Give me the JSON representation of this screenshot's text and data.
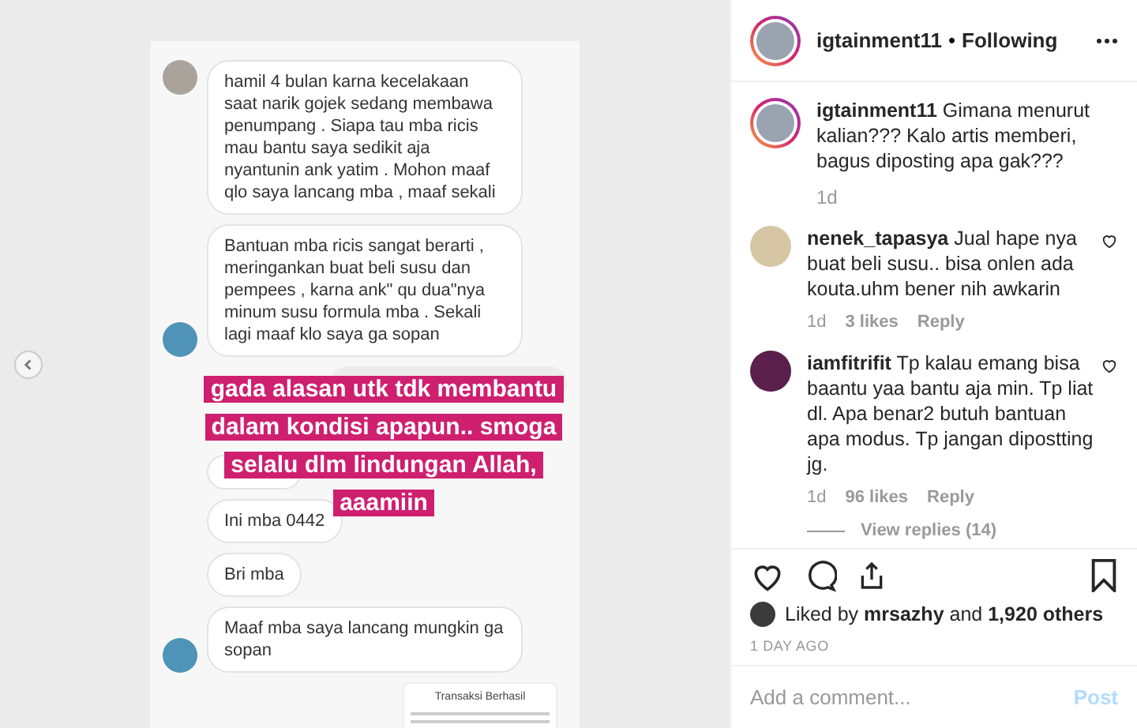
{
  "post_media": {
    "messages": [
      {
        "text": "hamil 4 bulan karna kecelakaan saat narik gojek sedang membawa penumpang . Siapa tau mba ricis mau bantu saya sedikit aja nyantunin ank yatim . Mohon maaf qlo saya lancang mba , maaf sekali",
        "kind": "avatar_top"
      },
      {
        "text": "Bantuan mba ricis sangat berarti , meringankan buat beli susu dan pempees , karna ank\" qu dua\"nya minum susu formula mba . Sekali lagi maaf klo saya ga sopan",
        "kind": "avatar_bottom"
      },
      {
        "text": "Ini mba 0442",
        "kind": "plain"
      },
      {
        "text": "Bri mba",
        "kind": "plain"
      },
      {
        "text": "Maaf mba saya lancang mungkin ga sopan",
        "kind": "avatar_bottom"
      }
    ],
    "overlay_caption": "gada alasan utk tdk membantu dalam kondisi apapun.. smoga selalu dlm lindungan Allah, aaamiin",
    "receipt_title": "Transaksi Berhasil"
  },
  "header": {
    "username": "igtainment11",
    "separator": "•",
    "follow_status": "Following"
  },
  "caption": {
    "username": "igtainment11",
    "text": "Gimana menurut kalian??? Kalo artis memberi, bagus diposting apa gak???",
    "time": "1d"
  },
  "comments": [
    {
      "username": "nenek_tapasya",
      "text": "Jual hape nya buat beli susu.. bisa onlen ada kouta.uhm bener nih awkarin",
      "time": "1d",
      "likes": "3 likes",
      "reply": "Reply",
      "liked": false
    },
    {
      "username": "iamfitrifit",
      "text": "Tp kalau emang bisa baantu yaa bantu aja min. Tp liat dl. Apa benar2 butuh bantuan apa modus. Tp jangan dipostting jg.",
      "time": "1d",
      "likes": "96 likes",
      "reply": "Reply",
      "liked": false,
      "view_replies": "View replies (14)"
    }
  ],
  "actions": {
    "liked": false,
    "saved": false
  },
  "likes_line": {
    "prefix": "Liked by",
    "user": "mrsazhy",
    "middle": "and",
    "count": "1,920 others"
  },
  "date": "1 DAY AGO",
  "comment_box": {
    "placeholder": "Add a comment...",
    "button": "Post"
  }
}
